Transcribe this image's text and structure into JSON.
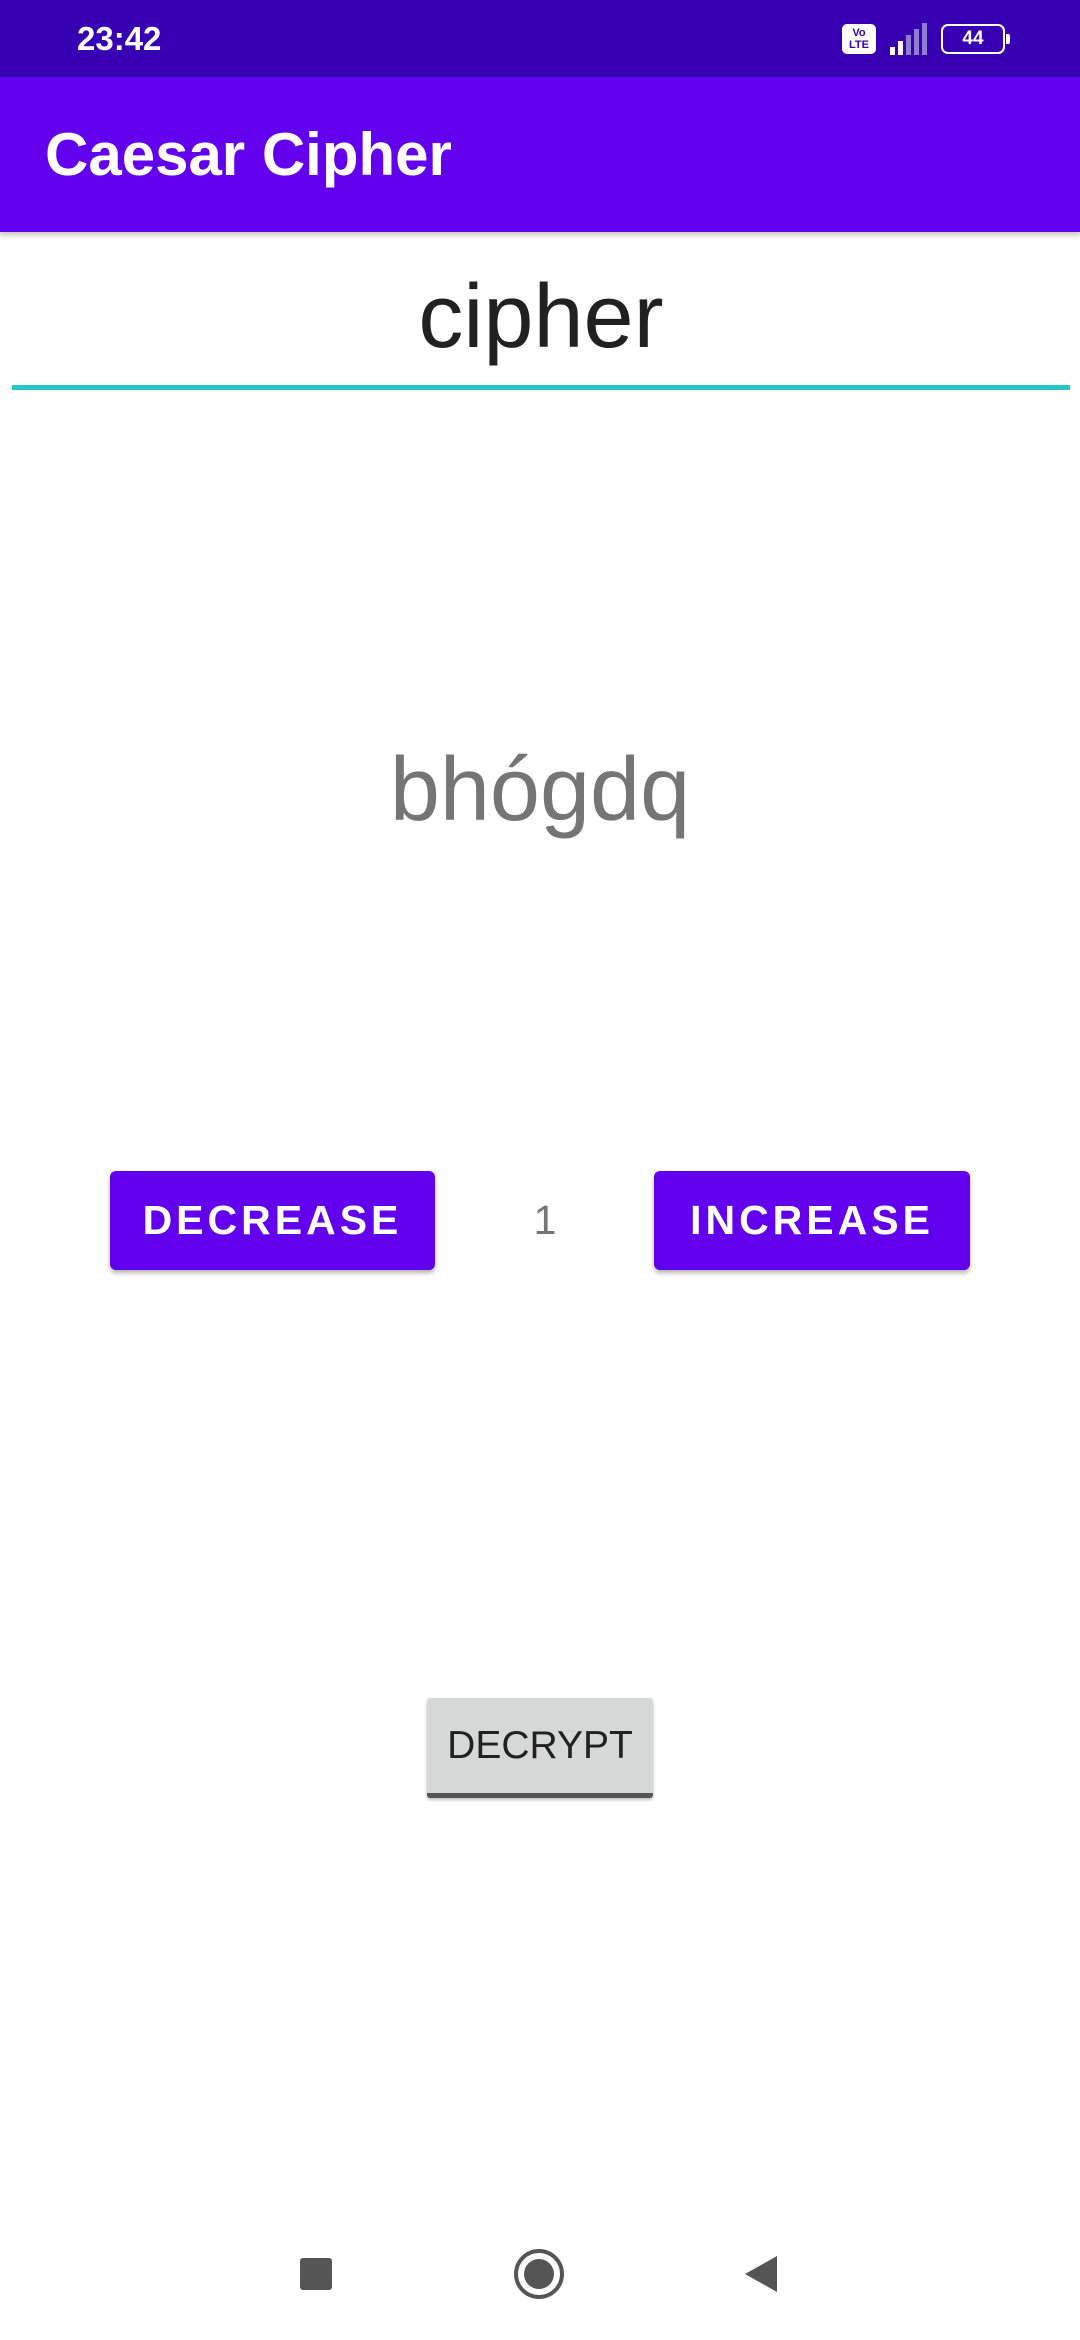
{
  "status_bar": {
    "time": "23:42",
    "volte_label": "Vo LTE",
    "battery_level": "44"
  },
  "app_bar": {
    "title": "Caesar Cipher"
  },
  "input": {
    "value": "cipher"
  },
  "output": {
    "text": "bhógdq"
  },
  "controls": {
    "decrease_label": "DECREASE",
    "shift_value": "1",
    "increase_label": "INCREASE"
  },
  "decrypt_button": {
    "label": "DECRYPT"
  },
  "nav": {
    "recents_icon": "square-icon",
    "home_icon": "circle-icon",
    "back_icon": "triangle-back-icon"
  },
  "colors": {
    "status_bar": "#3700b3",
    "primary": "#6200ee",
    "input_underline": "#26c6c6",
    "decrypt_button": "#d6d7d7"
  }
}
